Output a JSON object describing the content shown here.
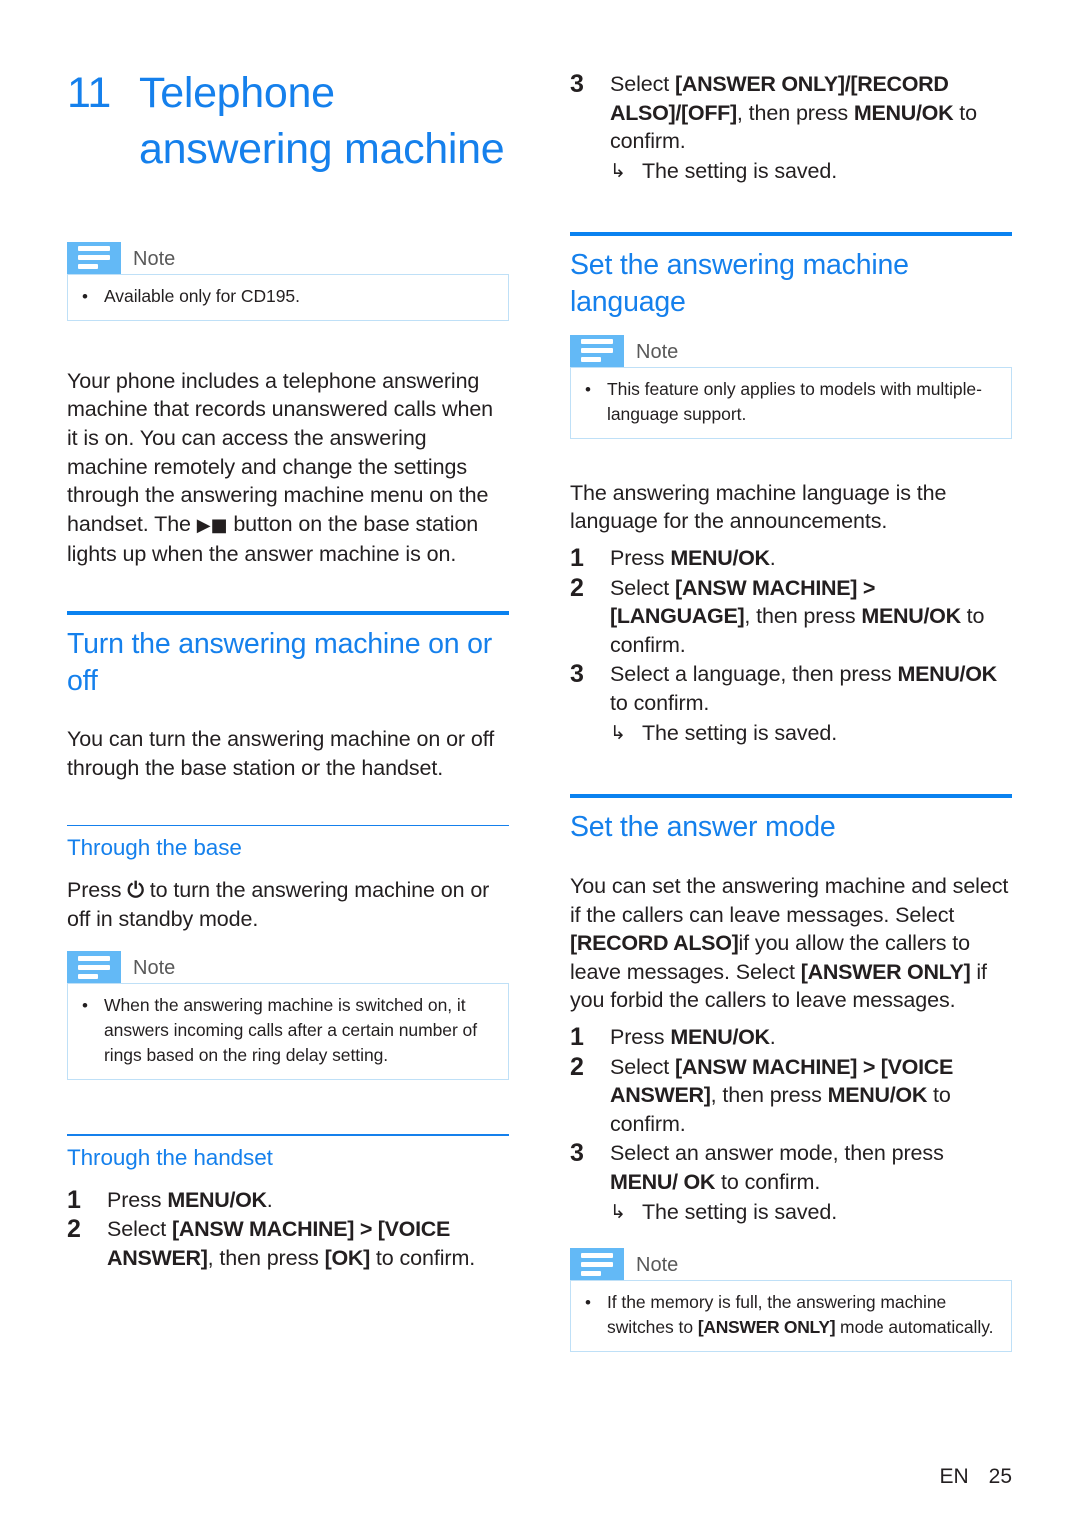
{
  "chapter": {
    "number": "11",
    "title": "Telephone answering machine"
  },
  "note_label": "Note",
  "bullet": "•",
  "arrow": "↳",
  "colors": {
    "heading_blue": "#1580ec",
    "rule_blue": "#0a82f0",
    "note_badge_blue": "#63b9f6",
    "note_border_blue": "#bfe0f7",
    "body_text": "#231f20"
  },
  "left_column": {
    "note_top": {
      "label": "Note",
      "items": [
        "Available only for CD195."
      ]
    },
    "intro_paragraph_part1": "Your phone includes a telephone answering machine that records unanswered calls when it is on. You can access the answering machine remotely and change the settings through the answering machine menu on the handset. The ",
    "intro_glyph": "▶■",
    "intro_paragraph_part2": " button on the base station lights up when the answer machine is on.",
    "section_turn": {
      "heading": "Turn the answering machine on or off",
      "paragraph": "You can turn the answering machine on or off through the base station or the handset."
    },
    "sub_base": {
      "heading": "Through the base",
      "paragraph_part1": "Press ",
      "power_glyph": "⏻",
      "paragraph_part2": " to turn the answering machine on or off in standby mode.",
      "note": {
        "label": "Note",
        "items": [
          "When the answering machine is switched on, it answers incoming calls after a certain number of rings based on the ring delay setting."
        ]
      }
    },
    "sub_handset": {
      "heading": "Through the handset",
      "steps": [
        {
          "num": "1",
          "text_plain": "Press ",
          "text_bold": "MENU/OK",
          "text_tail": "."
        },
        {
          "num": "2",
          "text_plain": "Select ",
          "text_bold": "[ANSW MACHINE] > [VOICE ANSWER]",
          "text_tail": ", then press ",
          "text_bold2": "[OK]",
          "text_tail2": " to confirm."
        }
      ]
    }
  },
  "right_column": {
    "continued_step": {
      "num": "3",
      "text_plain": "Select ",
      "text_bold": "[ANSWER ONLY]/[RECORD ALSO]/[OFF]",
      "text_tail": ", then press ",
      "text_bold2": "MENU/OK",
      "text_tail2": " to confirm.",
      "substep": "The setting is saved."
    },
    "section_language": {
      "heading": "Set the answering machine language",
      "note": {
        "label": "Note",
        "items": [
          "This feature only applies to models with multiple-language support."
        ]
      },
      "paragraph": "The answering machine language is the language for the announcements.",
      "steps": [
        {
          "num": "1",
          "text_plain": "Press ",
          "text_bold": "MENU/OK",
          "text_tail": "."
        },
        {
          "num": "2",
          "text_plain": "Select ",
          "text_bold": "[ANSW MACHINE] > [LANGUAGE]",
          "text_tail": ", then press ",
          "text_bold2": "MENU/OK",
          "text_tail2": " to confirm."
        },
        {
          "num": "3",
          "text_plain": "Select a language, then press ",
          "text_bold": "MENU/OK",
          "text_tail": " to confirm.",
          "substep": "The setting is saved."
        }
      ]
    },
    "section_answer_mode": {
      "heading": "Set the answer mode",
      "paragraph_part1": "You can set the answering machine and select if the callers can leave messages. Select ",
      "paragraph_bold1": "[RECORD ALSO]",
      "paragraph_part2": "if you allow the callers to leave messages. Select ",
      "paragraph_bold2": "[ANSWER ONLY]",
      "paragraph_part3": " if you forbid the callers to leave messages.",
      "steps": [
        {
          "num": "1",
          "text_plain": "Press ",
          "text_bold": "MENU/OK",
          "text_tail": "."
        },
        {
          "num": "2",
          "text_plain": "Select ",
          "text_bold": "[ANSW MACHINE] > [VOICE ANSWER]",
          "text_tail": ", then press ",
          "text_bold2": "MENU/OK",
          "text_tail2": " to confirm."
        },
        {
          "num": "3",
          "text_plain": "Select an answer mode, then press ",
          "text_bold": "MENU/ OK",
          "text_tail": " to confirm.",
          "substep": "The setting is saved."
        }
      ],
      "note": {
        "label": "Note",
        "items_prefix": "If the memory is full, the answering machine switches to ",
        "items_bold": "[ANSWER ONLY]",
        "items_suffix": " mode automatically."
      }
    }
  },
  "footer": {
    "language": "EN",
    "page_number": "25"
  }
}
